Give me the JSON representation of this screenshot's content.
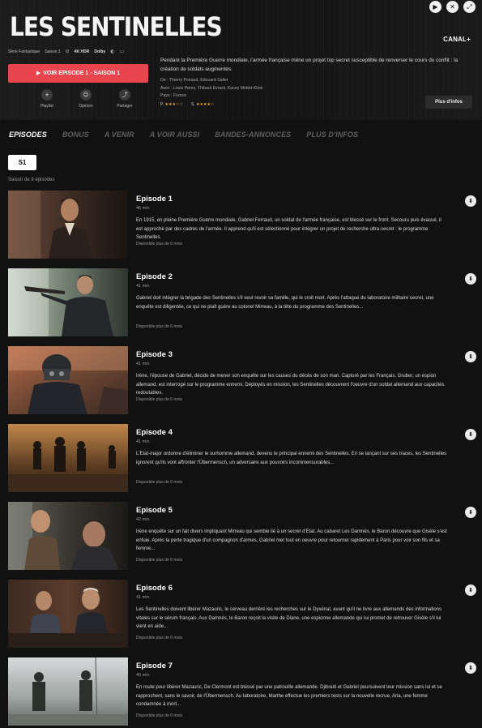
{
  "show": {
    "title": "LES SENTINELLES",
    "brand": "CANAL+",
    "genre": "Série Fantastique",
    "season_label": "Saison 1",
    "badge_4k": "4K HDR",
    "badge_dolby": "Dolby",
    "synopsis": "Pendant la Première Guerre mondiale, l'armée française mène un projet top secret susceptible de renverser le cours du conflit : la création de soldats augmentés.",
    "director": "De : Thierry Poiraud, Edouard Salier",
    "cast": "Avec : Louis Peres, Thibaut Evrard, Kacey Mottet-Klein",
    "country": "Pays : France",
    "rating_press_label": "P.",
    "rating_press_stars": "★★★☆☆",
    "rating_spect_label": "S.",
    "rating_spect_stars": "★★★★☆"
  },
  "actions": {
    "play_label": "VOIR EPISODE 1 - SAISON 1",
    "playlist": "Playlist",
    "opinion": "Opinion",
    "share": "Partager",
    "more_info": "Plus d'infos"
  },
  "tabs": [
    "EPISODES",
    "BONUS",
    "A VENIR",
    "A VOIR AUSSI",
    "BANDES-ANNONCES",
    "PLUS D'INFOS"
  ],
  "season": {
    "chip": "S1",
    "count": "Saison de 8 épisodes"
  },
  "episodes": [
    {
      "title": "Episode 1",
      "duration": "46 min",
      "description": "En 1915, en pleine Première Guerre mondiale, Gabriel Ferraud, un soldat de l'armée française, est blessé sur le front. Secouru puis évacué, il est approché par des cadres de l'armée. Il apprend qu'il est sélectionné pour intégrer un projet de recherche ultra-secret : le programme Sentinelles.",
      "availability": "Disponible plus de 6 mois"
    },
    {
      "title": "Episode 2",
      "duration": "41 min",
      "description": "Gabriel doit intégrer la brigade des Sentinelles s'il veut revoir sa famille, qui le croit mort. Après l'attaque du laboratoire militaire secret, une enquête est diligentée, ce qui ne plaît guère au colonel Mirreau, à la tête du programme des Sentinelles...",
      "availability": "Disponible plus de 6 mois"
    },
    {
      "title": "Episode 3",
      "duration": "41 min",
      "description": "Irène, l'épouse de Gabriel, décide de mener son enquête sur les causes du décès de son mari. Capturé par les Français, Gruber, un espion allemand, est interrogé sur le programme ennemi. Déployés en mission, les Sentinelles découvrent l'oeuvre d'un soldat allemand aux capacités redoutables.",
      "availability": "Disponible plus de 6 mois"
    },
    {
      "title": "Episode 4",
      "duration": "41 min",
      "description": "L'Etat-major ordonne d'éliminer le surhomme allemand, devenu le principal ennemi des Sentinelles. En se lançant sur ses traces, les Sentinelles ignorent qu'ils vont affronter l'Übermensch, un adversaire aux pouvoirs incommensurables...",
      "availability": "Disponible plus de 6 mois"
    },
    {
      "title": "Episode 5",
      "duration": "42 min",
      "description": "Irène enquête sur un fait divers impliquant Mirreau qui semble lié à un secret d'Etat. Au cabaret Les Damnés, le Baron découvre que Gisèle s'est enfuie. Après la perte tragique d'un compagnon d'armes, Gabriel met tout en oeuvre pour retourner rapidement à Paris pour voir son fils et sa femme...",
      "availability": "Disponible plus de 6 mois"
    },
    {
      "title": "Episode 6",
      "duration": "41 min",
      "description": "Les Sentinelles doivent libérer Mazauric, le cerveau derrière les recherches sur le Dyxénal, avant qu'il ne livre aux allemands des informations vitales sur le sérum français. Aux Damnés, le Baron reçoit la visite de Diane, une espionne allemande qui lui promet de retrouver Gisèle s'il lui vient en aide...",
      "availability": "Disponible plus de 6 mois"
    },
    {
      "title": "Episode 7",
      "duration": "40 min",
      "description": "En route pour libérer Mazauric, De Clermont est blessé par une patrouille allemande. Djibouti et Gabriel poursuivent leur mission sans lui et se rapprochent, sans le savoir, de l'Übermensch. Au laboratoire, Marthe effectue les premiers tests sur la nouvelle recrue, Aria, une femme condamnée à mort...",
      "availability": "Disponible plus de 6 mois"
    }
  ],
  "icons": {
    "play": "play-icon",
    "mute": "mute-icon",
    "fullscreen": "fullscreen-icon",
    "download": "download-icon",
    "accent": "#e9454f"
  }
}
